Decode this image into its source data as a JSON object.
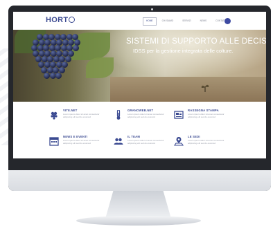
{
  "brand": {
    "logo_text": "HORT",
    "accent": "#3b4a91"
  },
  "nav": {
    "items": [
      {
        "label": "Home",
        "active": true
      },
      {
        "label": "Chi siamo",
        "active": false
      },
      {
        "label": "Servizi",
        "active": false
      },
      {
        "label": "News",
        "active": false
      },
      {
        "label": "Contatti",
        "active": false
      }
    ]
  },
  "hero": {
    "title": "SISTEMI DI SUPPORTO ALLE DECISIONI",
    "subtitle": "IDSS per la gestione integrata delle colture."
  },
  "services": [
    {
      "title": "VITE.NET",
      "icon": "grape-icon",
      "text": "Lorem ipsum dolor sit amet consectetur adipiscing elit sed do eiusmod"
    },
    {
      "title": "GRANOWEB.NET",
      "icon": "thermometer-icon",
      "text": "Lorem ipsum dolor sit amet consectetur adipiscing elit sed do eiusmod"
    },
    {
      "title": "RASSEGNA STAMPA",
      "icon": "newspaper-icon",
      "text": "Lorem ipsum dolor sit amet consectetur adipiscing elit sed do eiusmod"
    },
    {
      "title": "NEWS E EVENTI",
      "icon": "calendar-icon",
      "text": "Lorem ipsum dolor sit amet consectetur adipiscing elit sed do eiusmod"
    },
    {
      "title": "IL TEAM",
      "icon": "team-icon",
      "text": "Lorem ipsum dolor sit amet consectetur adipiscing elit sed do eiusmod"
    },
    {
      "title": "LE SEDI",
      "icon": "location-icon",
      "text": "Lorem ipsum dolor sit amet consectetur adipiscing elit sed do eiusmod"
    }
  ]
}
